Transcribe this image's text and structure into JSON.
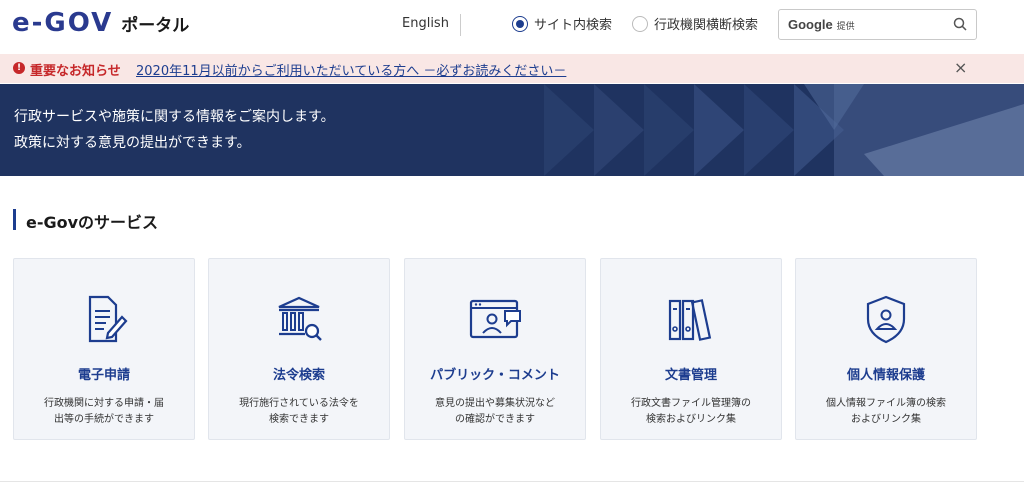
{
  "header": {
    "logo_text": "e-GOV",
    "logo_sub": "ポータル",
    "language": "English",
    "radio_site": "サイト内検索",
    "radio_gov": "行政機関横断検索",
    "search_brand": "Google",
    "search_provided": "提供"
  },
  "notice": {
    "label": "重要なお知らせ",
    "link": "2020年11月以前からご利用いただいている方へ －必ずお読みください－",
    "close": "×"
  },
  "hero": {
    "line1": "行政サービスや施策に関する情報をご案内します。",
    "line2": "政策に対する意見の提出ができます。"
  },
  "section": {
    "title": "e-Govのサービス"
  },
  "cards": [
    {
      "icon": "document-pen-icon",
      "title": "電子申請",
      "desc1": "行政機関に対する申請・届",
      "desc2": "出等の手続ができます"
    },
    {
      "icon": "building-search-icon",
      "title": "法令検索",
      "desc1": "現行施行されている法令を",
      "desc2": "検索できます"
    },
    {
      "icon": "browser-comment-icon",
      "title": "パブリック・コメント",
      "desc1": "意見の提出や募集状況など",
      "desc2": "の確認ができます"
    },
    {
      "icon": "binders-icon",
      "title": "文書管理",
      "desc1": "行政文書ファイル管理簿の",
      "desc2": "検索およびリンク集"
    },
    {
      "icon": "shield-person-icon",
      "title": "個人情報保護",
      "desc1": "個人情報ファイル簿の検索",
      "desc2": "およびリンク集"
    }
  ],
  "colors": {
    "brand": "#1d3d8f",
    "hero_bg": "#1f3360",
    "notice_bg": "#f9e7e5",
    "alert": "#c6282a"
  }
}
